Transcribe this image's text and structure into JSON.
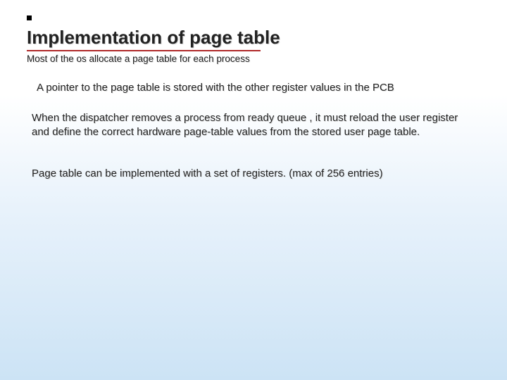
{
  "slide": {
    "title": "Implementation of page table",
    "subtitle": "Most of the os allocate a page table for each  process",
    "para1": "A pointer to the page table is stored with the other register values in the PCB",
    "para2": "When the dispatcher removes a process from ready queue , it must reload the user register and define the correct hardware page-table values from the stored user page table.",
    "para3": "Page table can be implemented with a set of registers. (max of 256 entries)"
  }
}
